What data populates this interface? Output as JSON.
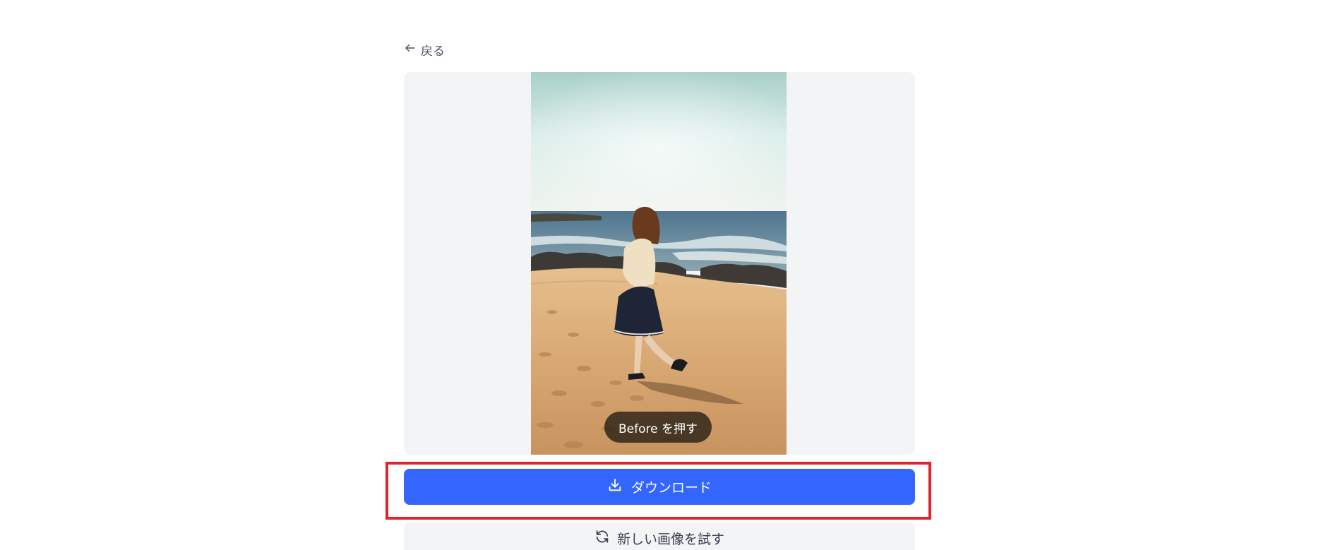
{
  "nav": {
    "back_label": "戻る",
    "back_icon": "arrow-left-icon"
  },
  "preview": {
    "before_label": "Before を押す"
  },
  "actions": {
    "download_label": "ダウンロード",
    "download_icon": "download-icon",
    "retry_label": "新しい画像を試す",
    "retry_icon": "refresh-icon"
  },
  "colors": {
    "primary": "#3366ff",
    "panel_bg": "#f3f4f6",
    "highlight": "#e0242e",
    "text": "#374151"
  }
}
